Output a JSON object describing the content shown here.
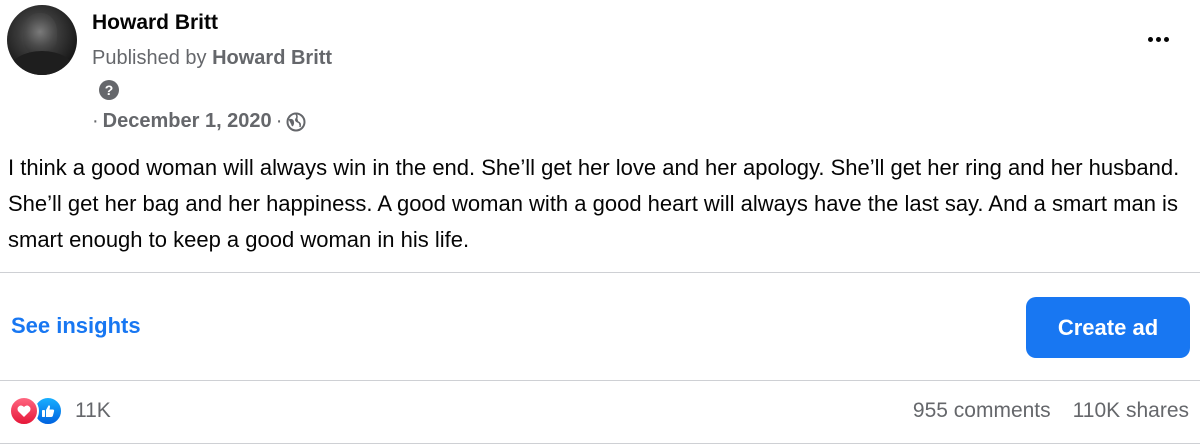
{
  "post": {
    "author": "Howard Britt",
    "published_prefix": "Published by",
    "publisher": "Howard Britt",
    "help_icon_glyph": "?",
    "date_prefix": "·",
    "date": "December 1, 2020",
    "date_separator": "·",
    "audience_icon": "globe-icon",
    "text": "I think a good woman will always win in the end. She’ll get her love and her apology. She’ll get her ring and her husband. She’ll get her bag and her happiness. A good woman with a good heart will always have the last say. And a smart man is smart enough to keep a good woman in his life."
  },
  "actions": {
    "see_insights": "See insights",
    "create_ad": "Create ad"
  },
  "engagement": {
    "reaction_icons": [
      "love-icon",
      "like-icon"
    ],
    "reactions_count": "11K",
    "comments": "955 comments",
    "shares": "110K shares"
  },
  "colors": {
    "accent": "#1877f2",
    "secondary_text": "#65676b",
    "divider": "#ced0d4"
  }
}
